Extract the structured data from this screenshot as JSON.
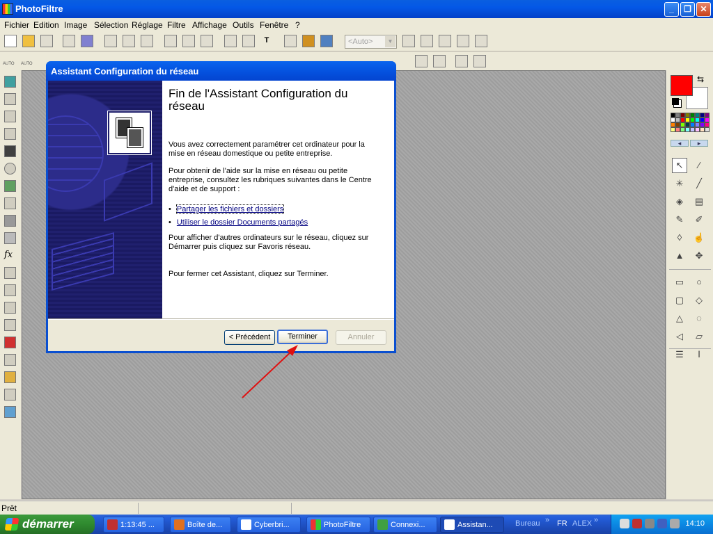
{
  "app": {
    "title": "PhotoFiltre"
  },
  "menu": [
    "Fichier",
    "Edition",
    "Image",
    "Sélection",
    "Réglage",
    "Filtre",
    "Affichage",
    "Outils",
    "Fenêtre",
    "?"
  ],
  "toolbar": {
    "zoom_placeholder": "<Auto>",
    "auto_label_1": "AUTO",
    "auto_label_2": "AUTO"
  },
  "palette": {
    "foreground": "#ff0000",
    "background": "#ffffff",
    "swatches": [
      "#000000",
      "#808080",
      "#800000",
      "#808000",
      "#008000",
      "#008080",
      "#000080",
      "#800080",
      "#ffffff",
      "#c0c0c0",
      "#ff0000",
      "#ffff00",
      "#00ff00",
      "#00ffff",
      "#0000ff",
      "#ff00ff",
      "#ff8000",
      "#804000",
      "#80ff00",
      "#004040",
      "#0080ff",
      "#8080ff",
      "#8000ff",
      "#ff0080",
      "#ffff80",
      "#ff8080",
      "#80ff80",
      "#80ffff",
      "#c0c0ff",
      "#ffc0ff",
      "#ffe0c0",
      "#e0e0e0"
    ]
  },
  "status": {
    "text": "Prêt"
  },
  "dialog": {
    "title": "Assistant Configuration du réseau",
    "heading": "Fin de l'Assistant Configuration du réseau",
    "para1": "Vous avez correctement paramétrer cet ordinateur pour la mise en réseau domestique ou petite entreprise.",
    "para2": "Pour obtenir de l'aide sur la mise en réseau ou petite entreprise, consultez les rubriques suivantes dans le Centre d'aide et de support :",
    "link1": "Partager les fichiers et dossiers",
    "link2": "Utiliser le dossier Documents partagés",
    "para3": "Pour afficher d'autres ordinateurs sur le réseau, cliquez sur Démarrer puis cliquez sur Favoris réseau.",
    "para4": "Pour fermer cet Assistant, cliquez sur Terminer.",
    "btn_back": "< Précédent",
    "btn_finish": "Terminer",
    "btn_cancel": "Annuler"
  },
  "taskbar": {
    "start": "démarrer",
    "tasks": [
      "1:13:45 ...",
      "Boîte de...",
      "Cyberbri...",
      "PhotoFiltre",
      "Connexi...",
      "Assistan..."
    ],
    "bureau": "Bureau",
    "lang": "FR",
    "user": "ALEX",
    "clock": "14:10"
  }
}
